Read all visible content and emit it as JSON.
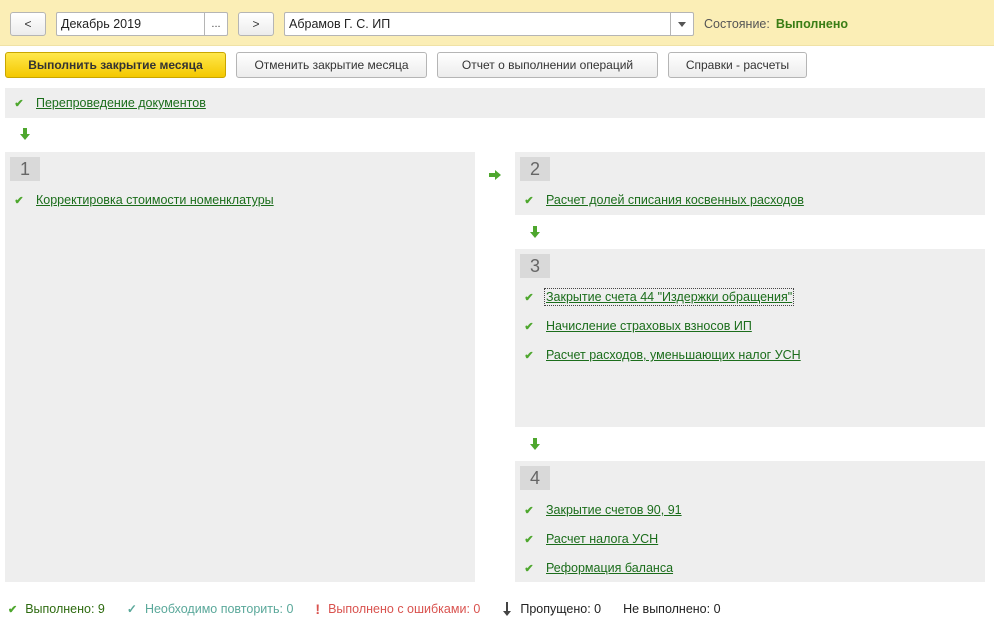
{
  "toolbar": {
    "prev_label": "<",
    "period_value": "Декабрь 2019",
    "period_select_label": "...",
    "next_label": ">",
    "org_value": "Абрамов Г. С. ИП",
    "state_label": "Состояние:",
    "state_value": "Выполнено"
  },
  "actions": {
    "run_label": "Выполнить закрытие месяца",
    "cancel_label": "Отменить закрытие месяца",
    "report_label": "Отчет о выполнении операций",
    "reference_label": "Справки - расчеты"
  },
  "pre_step": {
    "label": "Перепроведение документов",
    "status": "done"
  },
  "stages": [
    {
      "number": "1",
      "operations": [
        {
          "label": "Корректировка стоимости номенклатуры",
          "status": "done"
        }
      ]
    },
    {
      "number": "2",
      "operations": [
        {
          "label": "Расчет долей списания косвенных расходов",
          "status": "done"
        }
      ]
    },
    {
      "number": "3",
      "operations": [
        {
          "label": "Закрытие счета 44 \"Издержки обращения\"",
          "status": "done"
        },
        {
          "label": "Начисление страховых взносов ИП",
          "status": "done"
        },
        {
          "label": "Расчет расходов, уменьшающих налог УСН",
          "status": "done"
        }
      ]
    },
    {
      "number": "4",
      "operations": [
        {
          "label": "Закрытие счетов 90, 91",
          "status": "done"
        },
        {
          "label": "Расчет налога УСН",
          "status": "done"
        },
        {
          "label": "Реформация баланса",
          "status": "done"
        }
      ]
    }
  ],
  "footer": {
    "done_label": "Выполнено: 9",
    "repeat_label": "Необходимо повторить: 0",
    "errors_label": "Выполнено с ошибками: 0",
    "skipped_label": "Пропущено: 0",
    "not_done_label": "Не выполнено: 0"
  },
  "colors": {
    "topbar_bg": "#fbeeb6",
    "accent_button": "#f4c800",
    "done_green": "#4ea72e",
    "link_green": "#1b6d1b",
    "repeat_teal": "#5aa89a",
    "error_red": "#d9534f"
  },
  "icons": {
    "done": "check-icon",
    "repeat": "check-outline-icon",
    "errors": "exclamation-icon",
    "skipped": "arrow-down-icon",
    "flow_down": "green-arrow-down-icon",
    "flow_right": "green-arrow-right-icon"
  }
}
